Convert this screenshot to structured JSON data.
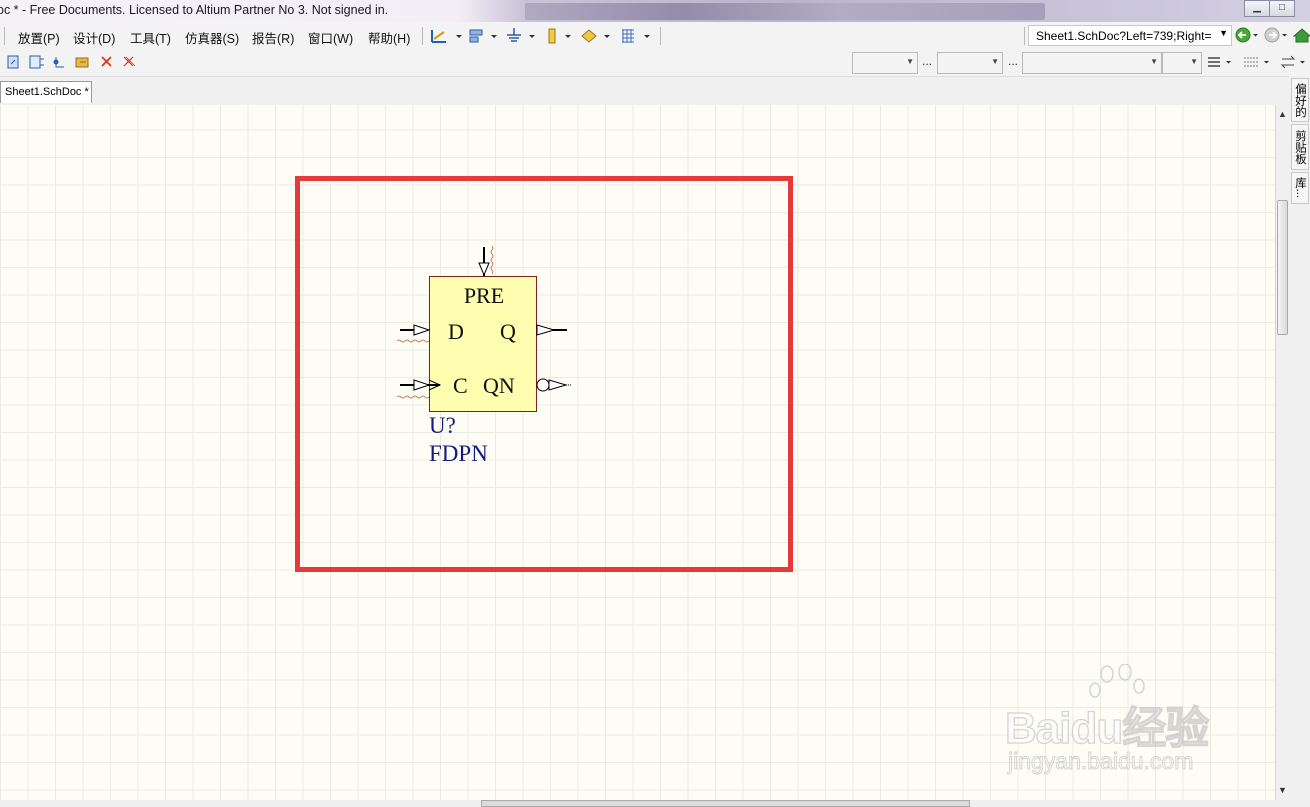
{
  "window": {
    "title": "oc * - Free Documents. Licensed to Altium Partner No 3. Not signed in.",
    "buttons": {
      "minimize": "▁",
      "maximize": "□"
    }
  },
  "menu": {
    "items": [
      "放置(P)",
      "设计(D)",
      "工具(T)",
      "仿真器(S)",
      "报告(R)",
      "窗口(W)",
      "帮助(H)"
    ]
  },
  "address": {
    "value": "Sheet1.SchDoc?Left=739;Right="
  },
  "toolbar2": {
    "ellipsis": "..."
  },
  "tabs": {
    "active": "Sheet1.SchDoc *"
  },
  "side_panels": [
    "偏好的",
    "剪贴板",
    "库..."
  ],
  "component": {
    "pins": {
      "top": "PRE",
      "d": "D",
      "q": "Q",
      "c": "C",
      "qn": "QN"
    },
    "designator": "U?",
    "comment": "FDPN"
  },
  "colors": {
    "highlight_box": "#e53a3a",
    "component_fill": "#fefdb0",
    "component_border": "#7a2222",
    "designator_text": "#151a7a",
    "canvas_bg": "#fdfcf5"
  },
  "watermark": {
    "main": "Baidu经验",
    "sub": "jingyan.baidu.com"
  }
}
